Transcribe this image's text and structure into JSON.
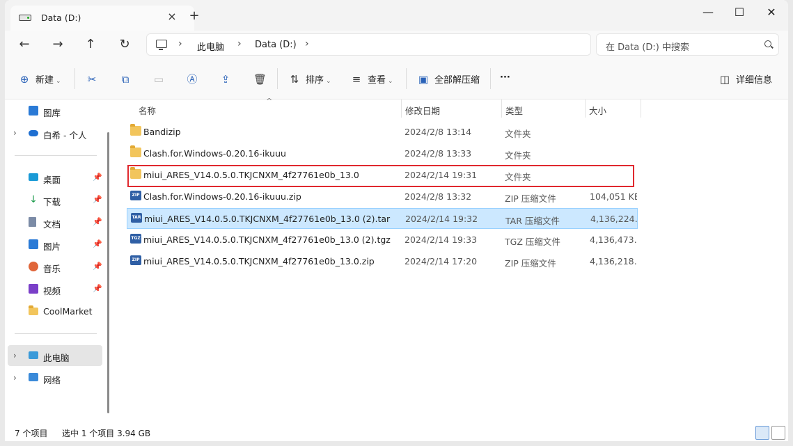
{
  "tab": {
    "title": "Data (D:)"
  },
  "breadcrumb": [
    "此电脑",
    "Data (D:)"
  ],
  "search": {
    "placeholder": "在 Data (D:) 中搜索"
  },
  "toolbar": {
    "new_label": "新建",
    "sort_label": "排序",
    "view_label": "查看",
    "extract_label": "全部解压缩",
    "more_label": "···",
    "details_label": "详细信息"
  },
  "sidebar": {
    "items": [
      {
        "label": "图库",
        "icon": "gallery-icon"
      },
      {
        "label": "白希 - 个人",
        "icon": "onedrive-icon"
      },
      {
        "label": "桌面",
        "icon": "desktop-icon"
      },
      {
        "label": "下载",
        "icon": "download-icon"
      },
      {
        "label": "文档",
        "icon": "documents-icon"
      },
      {
        "label": "图片",
        "icon": "pictures-icon"
      },
      {
        "label": "音乐",
        "icon": "music-icon"
      },
      {
        "label": "视频",
        "icon": "videos-icon"
      },
      {
        "label": "CoolMarket",
        "icon": "folder-icon"
      },
      {
        "label": "此电脑",
        "icon": "this-pc-icon"
      },
      {
        "label": "网络",
        "icon": "network-icon"
      }
    ]
  },
  "columns": {
    "name": "名称",
    "date": "修改日期",
    "type": "类型",
    "size": "大小"
  },
  "files": [
    {
      "name": "Bandizip",
      "date": "2024/2/8 13:14",
      "type": "文件夹",
      "size": ""
    },
    {
      "name": "Clash.for.Windows-0.20.16-ikuuu",
      "date": "2024/2/8 13:33",
      "type": "文件夹",
      "size": ""
    },
    {
      "name": "miui_ARES_V14.0.5.0.TKJCNXM_4f27761e0b_13.0",
      "date": "2024/2/14 19:31",
      "type": "文件夹",
      "size": ""
    },
    {
      "name": "Clash.for.Windows-0.20.16-ikuuu.zip",
      "date": "2024/2/8 13:32",
      "type": "ZIP 压缩文件",
      "size": "104,051 KB"
    },
    {
      "name": "miui_ARES_V14.0.5.0.TKJCNXM_4f27761e0b_13.0 (2).tar",
      "date": "2024/2/14 19:32",
      "type": "TAR 压缩文件",
      "size": "4,136,224…"
    },
    {
      "name": "miui_ARES_V14.0.5.0.TKJCNXM_4f27761e0b_13.0 (2).tgz",
      "date": "2024/2/14 19:33",
      "type": "TGZ 压缩文件",
      "size": "4,136,473…"
    },
    {
      "name": "miui_ARES_V14.0.5.0.TKJCNXM_4f27761e0b_13.0.zip",
      "date": "2024/2/14 17:20",
      "type": "ZIP 压缩文件",
      "size": "4,136,218…"
    }
  ],
  "status": {
    "count": "7 个项目",
    "selection": "选中 1 个项目  3.94 GB"
  },
  "colors": {
    "selection": "#cce8ff",
    "highlight_border": "#e0282e",
    "folder": "#f2c55c",
    "archive": "#2f5fa5"
  }
}
